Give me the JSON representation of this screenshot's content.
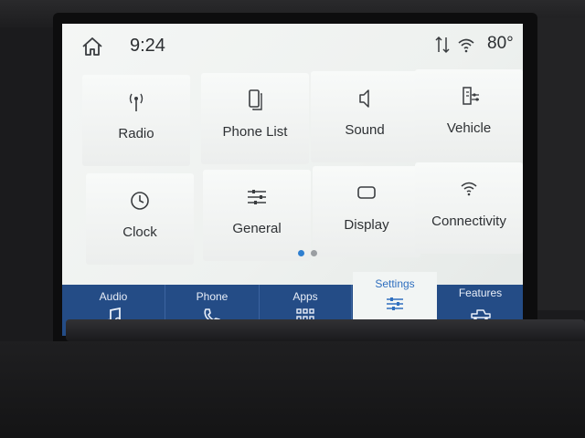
{
  "status": {
    "time": "9:24",
    "temperature": "80°"
  },
  "tiles": [
    {
      "label": "Radio",
      "icon": "radio-antenna-icon"
    },
    {
      "label": "Phone List",
      "icon": "phone-list-icon"
    },
    {
      "label": "Sound",
      "icon": "speaker-icon"
    },
    {
      "label": "Vehicle",
      "icon": "vehicle-settings-icon"
    },
    {
      "label": "Clock",
      "icon": "clock-icon"
    },
    {
      "label": "General",
      "icon": "sliders-icon"
    },
    {
      "label": "Display",
      "icon": "display-icon"
    },
    {
      "label": "Connectivity",
      "icon": "wifi-icon"
    }
  ],
  "pager": {
    "pages": 2,
    "current": 1
  },
  "nav": [
    {
      "label": "Audio",
      "icon": "music-note-icon"
    },
    {
      "label": "Phone",
      "icon": "phone-icon"
    },
    {
      "label": "Apps",
      "icon": "apps-grid-icon"
    },
    {
      "label": "Settings",
      "icon": "settings-sliders-icon",
      "active": true
    },
    {
      "label": "Features",
      "icon": "truck-icon"
    }
  ],
  "colors": {
    "nav_background": "#244c86",
    "active_tab_text": "#2f6fbf",
    "pager_active": "#2f7fd0",
    "pager_inactive": "#9a9ea2"
  }
}
